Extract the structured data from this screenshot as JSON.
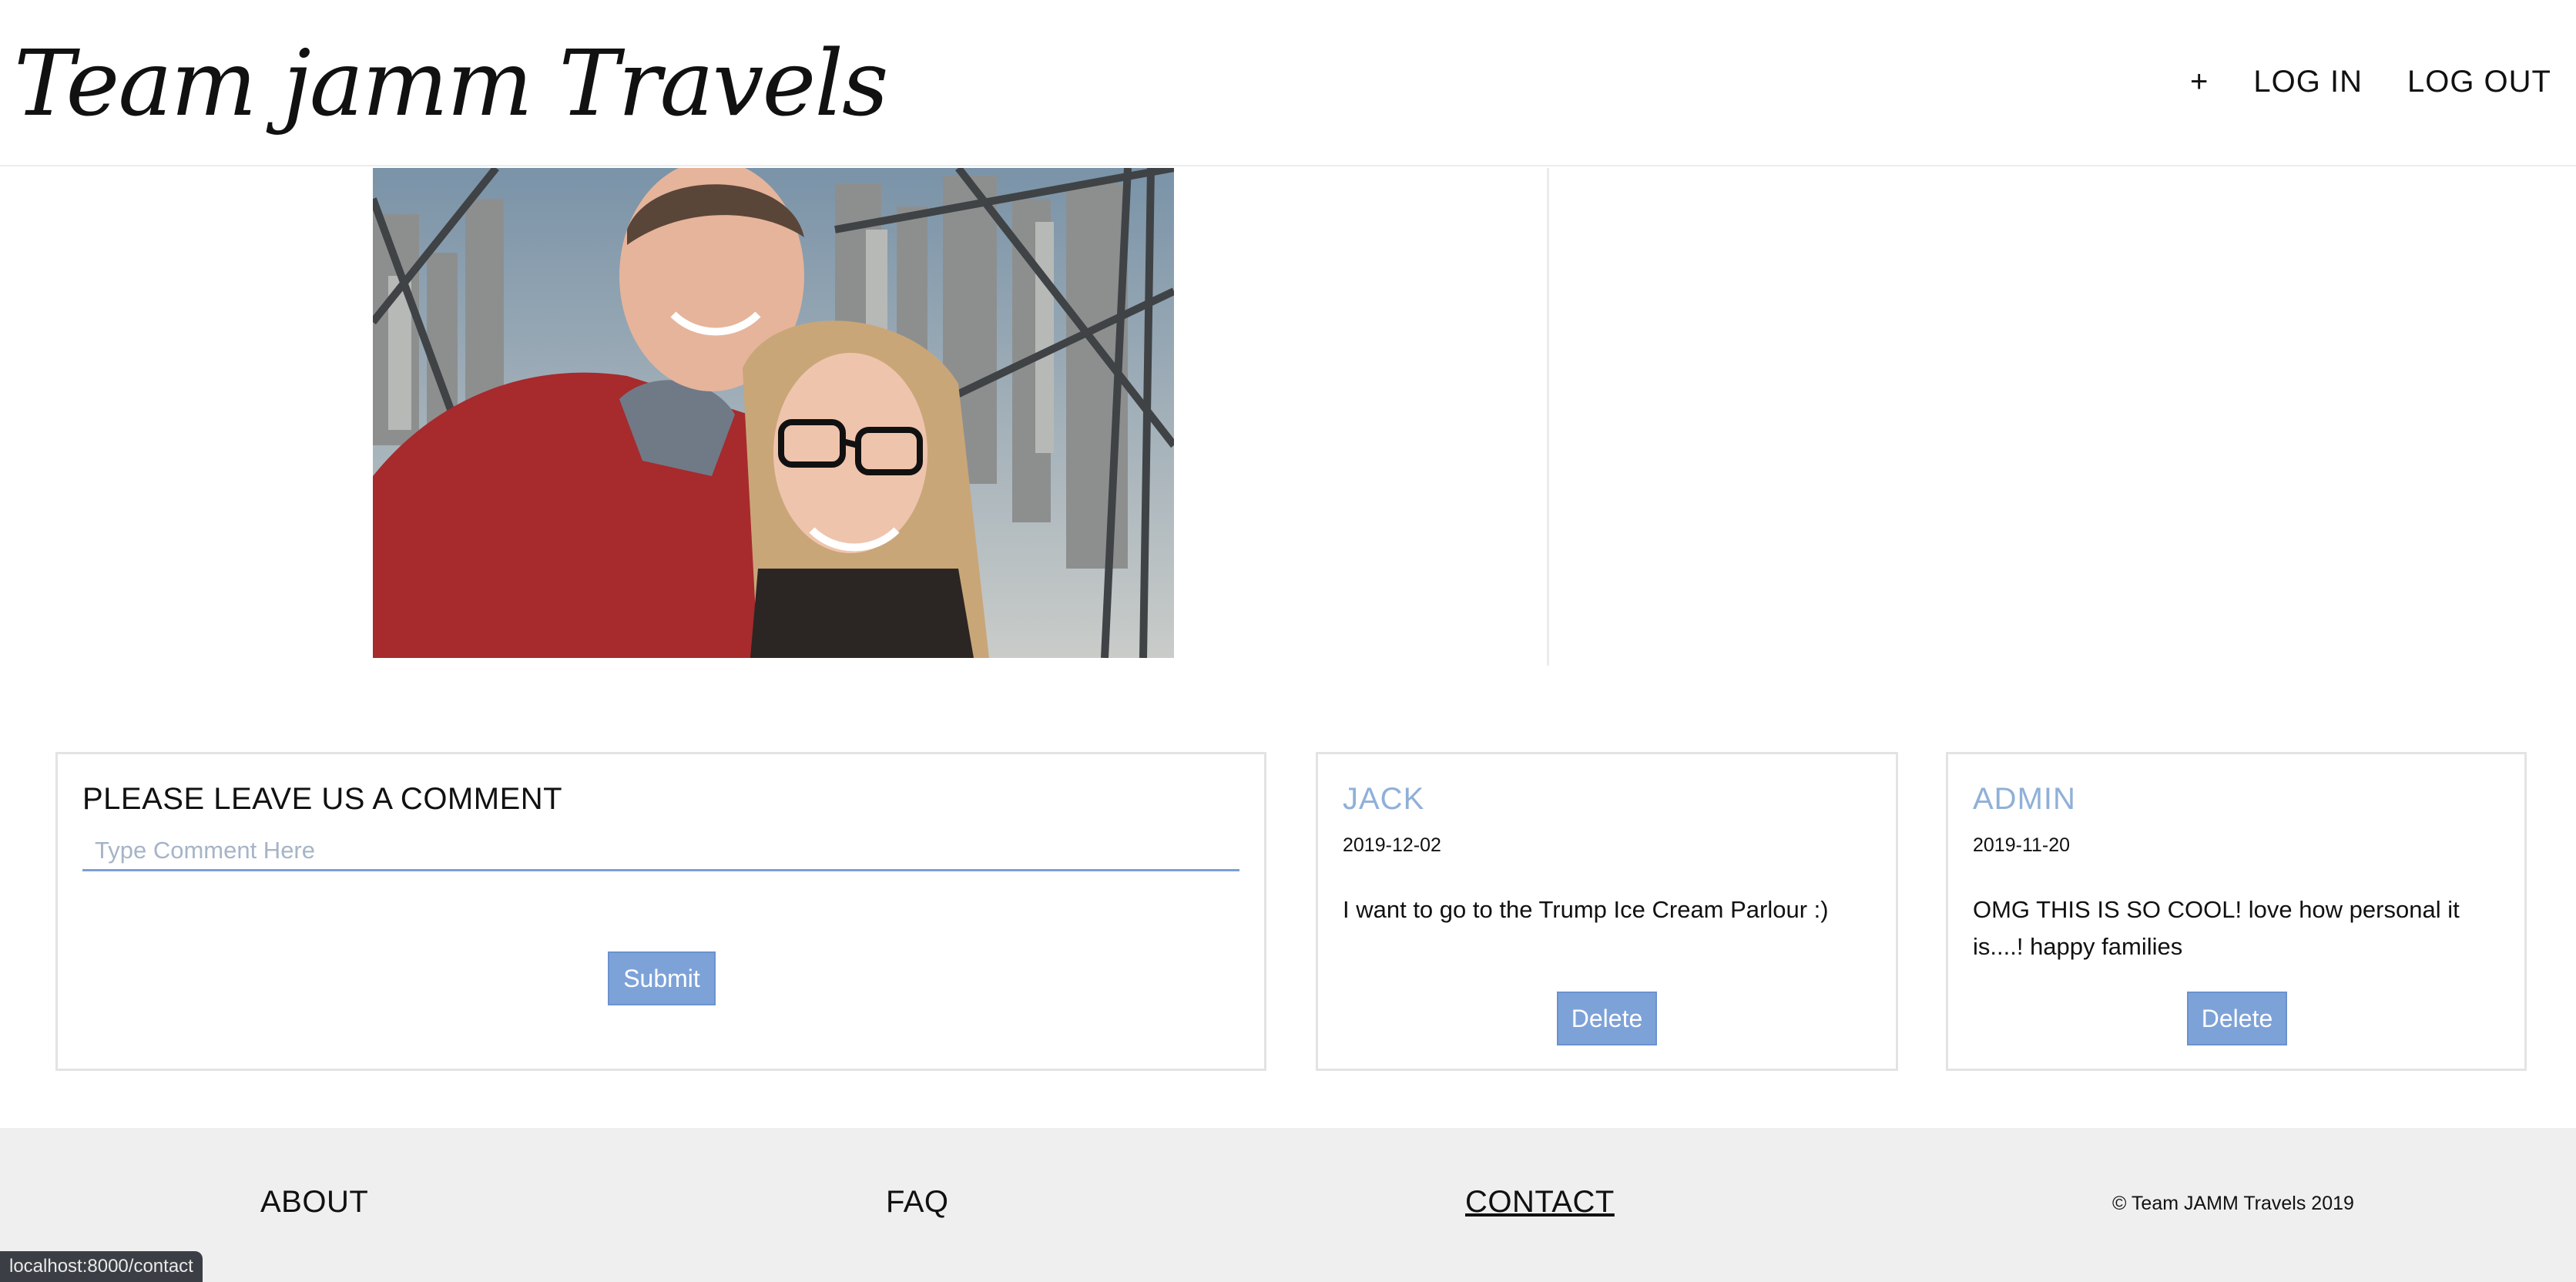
{
  "header": {
    "logo_text": "Team jamm Travels",
    "nav": {
      "add_label": "+",
      "login_label": "LOG IN",
      "logout_label": "LOG OUT"
    }
  },
  "photo": {
    "description_icon": "selfie-photo"
  },
  "comment_form": {
    "title": "PLEASE LEAVE US A COMMENT",
    "input_placeholder": "Type Comment Here",
    "input_value": "",
    "submit_label": "Submit"
  },
  "comments": [
    {
      "author": "JACK",
      "date": "2019-12-02",
      "text": "I want to go to the Trump Ice Cream Parlour :)",
      "delete_label": "Delete"
    },
    {
      "author": "ADMIN",
      "date": "2019-11-20",
      "text": "OMG THIS IS SO COOL! love how personal it is....! happy families",
      "delete_label": "Delete"
    }
  ],
  "footer": {
    "about_label": "ABOUT",
    "faq_label": "FAQ",
    "contact_label": "CONTACT",
    "copyright": "© Team JAMM Travels 2019"
  },
  "status_bar": {
    "url": "localhost:8000/contact"
  },
  "colors": {
    "accent": "#7da2d8",
    "author_name": "#8fb0d8",
    "footer_bg": "#efefef"
  }
}
